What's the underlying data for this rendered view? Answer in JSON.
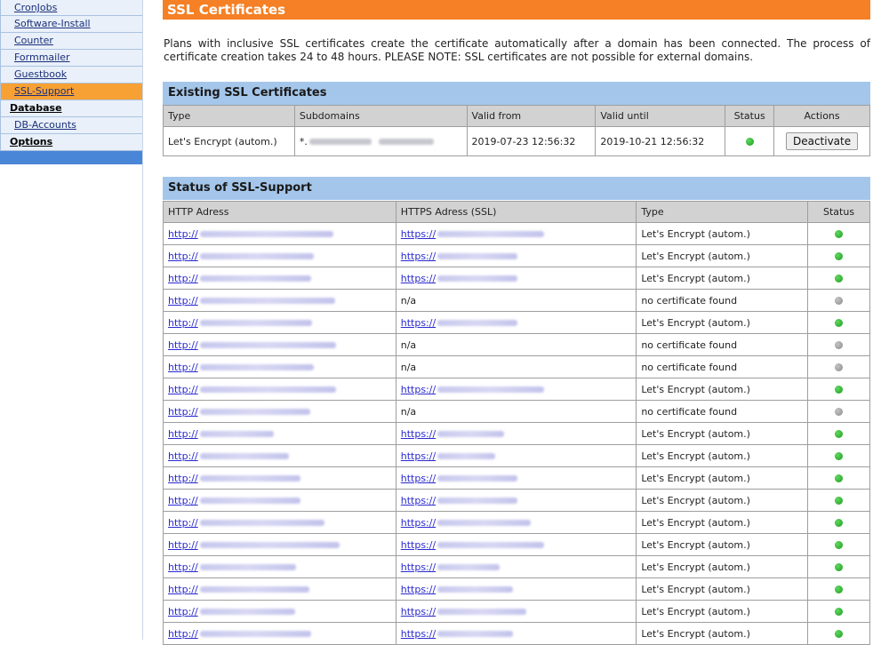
{
  "sidebar": {
    "items": [
      {
        "label": "CronJobs",
        "level": "sub"
      },
      {
        "label": "Software-Install",
        "level": "sub"
      },
      {
        "label": "Counter",
        "level": "sub"
      },
      {
        "label": "Formmailer",
        "level": "sub"
      },
      {
        "label": "Guestbook",
        "level": "sub"
      },
      {
        "label": "SSL-Support",
        "level": "sub",
        "active": true
      },
      {
        "label": "Database",
        "level": "main"
      },
      {
        "label": "DB-Accounts",
        "level": "sub"
      },
      {
        "label": "Options",
        "level": "main"
      }
    ]
  },
  "page": {
    "title": "SSL Certificates",
    "intro": "Plans with inclusive SSL certificates create the certificate automatically after a domain has been connected. The process of certificate creation takes 24 to 48 hours. PLEASE NOTE: SSL certificates are not possible for external domains."
  },
  "existing": {
    "title": "Existing SSL Certificates",
    "columns": {
      "type": "Type",
      "subdomains": "Subdomains",
      "valid_from": "Valid from",
      "valid_until": "Valid until",
      "status": "Status",
      "actions": "Actions"
    },
    "row": {
      "type": "Let's Encrypt (autom.)",
      "subdomain_prefix": "*.",
      "valid_from": "2019-07-23 12:56:32",
      "valid_until": "2019-10-21 12:56:32",
      "status": "active",
      "action_label": "Deactivate"
    }
  },
  "ssl_status": {
    "title": "Status of SSL-Support",
    "columns": {
      "http": "HTTP Adress",
      "https": "HTTPS Adress (SSL)",
      "type": "Type",
      "status": "Status"
    },
    "http_prefix": "http://",
    "https_prefix": "https://",
    "na_text": "n/a",
    "rows": [
      {
        "https": true,
        "type": "Let's Encrypt (autom.)",
        "status": "green"
      },
      {
        "https": true,
        "type": "Let's Encrypt (autom.)",
        "status": "green"
      },
      {
        "https": true,
        "type": "Let's Encrypt (autom.)",
        "status": "green"
      },
      {
        "https": false,
        "type": "no certificate found",
        "status": "grey"
      },
      {
        "https": true,
        "type": "Let's Encrypt (autom.)",
        "status": "green"
      },
      {
        "https": false,
        "type": "no certificate found",
        "status": "grey"
      },
      {
        "https": false,
        "type": "no certificate found",
        "status": "grey"
      },
      {
        "https": true,
        "type": "Let's Encrypt (autom.)",
        "status": "green"
      },
      {
        "https": false,
        "type": "no certificate found",
        "status": "grey"
      },
      {
        "https": true,
        "type": "Let's Encrypt (autom.)",
        "status": "green"
      },
      {
        "https": true,
        "type": "Let's Encrypt (autom.)",
        "status": "green"
      },
      {
        "https": true,
        "type": "Let's Encrypt (autom.)",
        "status": "green"
      },
      {
        "https": true,
        "type": "Let's Encrypt (autom.)",
        "status": "green"
      },
      {
        "https": true,
        "type": "Let's Encrypt (autom.)",
        "status": "green"
      },
      {
        "https": true,
        "type": "Let's Encrypt (autom.)",
        "status": "green"
      },
      {
        "https": true,
        "type": "Let's Encrypt (autom.)",
        "status": "green"
      },
      {
        "https": true,
        "type": "Let's Encrypt (autom.)",
        "status": "green"
      },
      {
        "https": true,
        "type": "Let's Encrypt (autom.)",
        "status": "green"
      },
      {
        "https": true,
        "type": "Let's Encrypt (autom.)",
        "status": "green"
      }
    ]
  },
  "colors": {
    "title_bar": "#f58025",
    "section_bar": "#a4c6ea",
    "sidebar_active": "#f7a033",
    "status_green": "#2db52d",
    "status_grey": "#9a9a9a"
  }
}
